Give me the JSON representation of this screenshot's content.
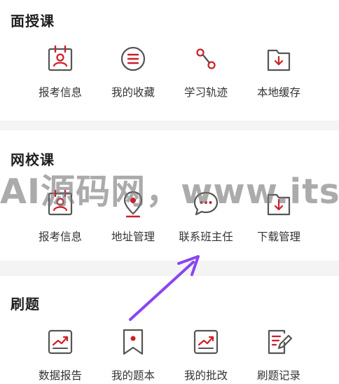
{
  "colors": {
    "accent": "#cc1f28",
    "icon_gray": "#555555",
    "arrow": "#8a45ef"
  },
  "sections": [
    {
      "title": "面授课",
      "items": [
        {
          "label": "报考信息",
          "icon": "id-card-icon"
        },
        {
          "label": "我的收藏",
          "icon": "list-circle-icon"
        },
        {
          "label": "学习轨迹",
          "icon": "route-icon"
        },
        {
          "label": "本地缓存",
          "icon": "folder-download-icon"
        }
      ]
    },
    {
      "title": "网校课",
      "items": [
        {
          "label": "报考信息",
          "icon": "id-card-icon"
        },
        {
          "label": "地址管理",
          "icon": "location-icon"
        },
        {
          "label": "联系班主任",
          "icon": "chat-bubble-icon"
        },
        {
          "label": "下载管理",
          "icon": "folder-download-icon"
        }
      ]
    },
    {
      "title": "刷题",
      "items": [
        {
          "label": "数据报告",
          "icon": "trend-chart-icon"
        },
        {
          "label": "我的题本",
          "icon": "bookmark-icon"
        },
        {
          "label": "我的批改",
          "icon": "trend-chart-icon"
        },
        {
          "label": "刷题记录",
          "icon": "edit-note-icon"
        }
      ]
    }
  ],
  "watermark": "AI源码网，www.itsegr.com"
}
